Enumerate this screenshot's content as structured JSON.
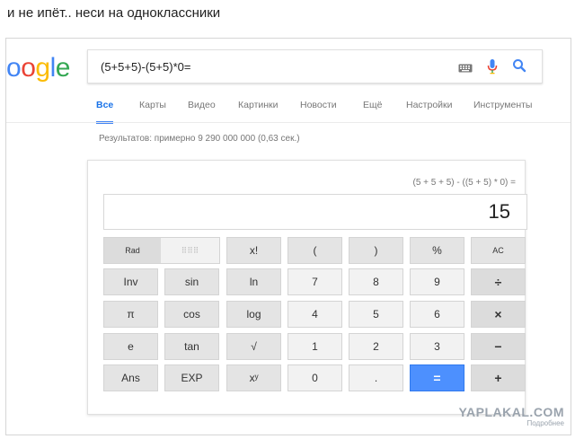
{
  "caption": "и не ипёт.. неси на одноклассники",
  "logo": {
    "text": "oogle",
    "colors": [
      "#4285f4",
      "#ea4335",
      "#fbbc05",
      "#4285f4",
      "#34a853",
      "#ea4335"
    ]
  },
  "search": {
    "query": "(5+5+5)-(5+5)*0="
  },
  "icons": {
    "keyboard": "keyboard-icon",
    "mic": "mic-icon",
    "search": "search-icon"
  },
  "tabs": [
    {
      "label": "Все",
      "active": true
    },
    {
      "label": "Карты",
      "active": false
    },
    {
      "label": "Видео",
      "active": false
    },
    {
      "label": "Картинки",
      "active": false
    },
    {
      "label": "Новости",
      "active": false
    },
    {
      "label": "Ещё",
      "active": false
    },
    {
      "label": "Настройки",
      "active": false
    },
    {
      "label": "Инструменты",
      "active": false
    }
  ],
  "results_stats": "Результатов: примерно 9 290 000 000 (0,63 сек.)",
  "calculator": {
    "expression": "(5 + 5 + 5) - ((5 + 5) * 0) =",
    "result": "15",
    "rad_label": "Rad",
    "deg_label": "⠿⠿⠿",
    "rows": [
      [
        "x!",
        "(",
        ")",
        "%",
        "AC"
      ],
      [
        "Inv",
        "sin",
        "ln",
        "7",
        "8",
        "9",
        "÷"
      ],
      [
        "π",
        "cos",
        "log",
        "4",
        "5",
        "6",
        "×"
      ],
      [
        "e",
        "tan",
        "√",
        "1",
        "2",
        "3",
        "−"
      ],
      [
        "Ans",
        "EXP",
        "xʸ",
        "0",
        ".",
        "=",
        "+"
      ]
    ]
  },
  "watermark": {
    "main": "YAPLAKAL.COM",
    "sub": "Подробнее"
  }
}
